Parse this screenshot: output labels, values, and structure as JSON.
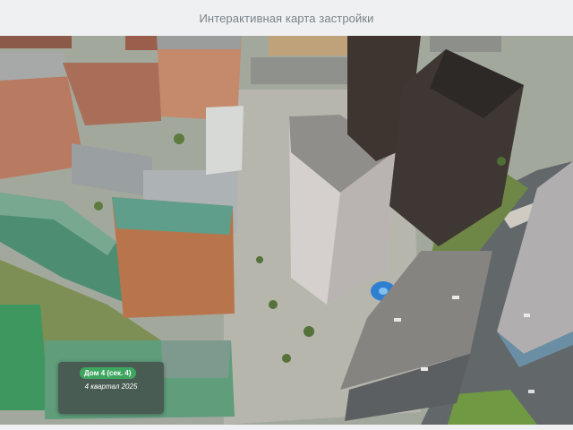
{
  "header": {
    "title": "Интерактивная карта застройки"
  },
  "map": {
    "tooltip": {
      "building": "Дом 4 (сек. 4)",
      "completion": "4 квартал 2025"
    },
    "colors": {
      "available_highlight": "#3fa660",
      "tooltip_background": "#444e4c",
      "header_text": "#7a8288"
    }
  }
}
